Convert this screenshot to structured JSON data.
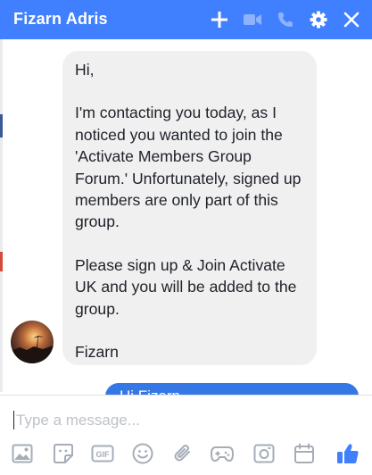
{
  "header": {
    "title": "Fizarn Adris",
    "icons": [
      "plus-icon",
      "video-icon",
      "phone-icon",
      "gear-icon",
      "close-icon"
    ]
  },
  "messages": {
    "incoming": {
      "greeting": "Hi,",
      "body": "I'm contacting you today, as I noticed you wanted to join the 'Activate Members Group Forum.' Unfortunately, signed up members are only part of this group.",
      "cta": "Please sign up & Join Activate UK and you will be added to the group.",
      "signature": "Fizarn"
    },
    "outgoing": {
      "text": "Hi Fizarn"
    }
  },
  "composer": {
    "placeholder": "Type a message...",
    "tools": [
      "image-icon",
      "sticker-icon",
      "gif-icon",
      "emoji-icon",
      "attachment-icon",
      "game-icon",
      "camera-icon",
      "calendar-icon",
      "like-icon"
    ]
  },
  "colors": {
    "header": "#4080ff",
    "outgoing_bubble": "#3578e5",
    "incoming_bubble": "#f1f0f0",
    "toolbar_icon": "#a6adb7",
    "like": "#4080ff"
  }
}
